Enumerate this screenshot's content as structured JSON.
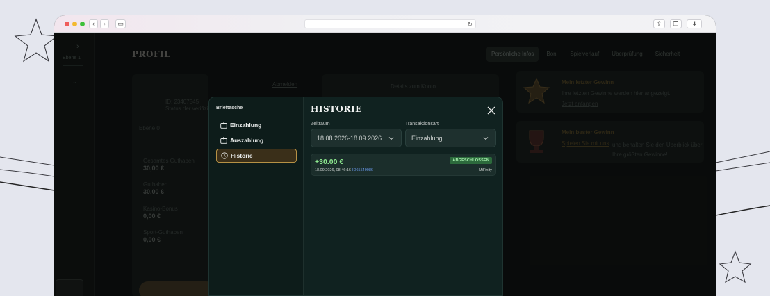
{
  "page": {
    "title": "PROFIL",
    "tabs": [
      {
        "label": "Persönliche Infos"
      },
      {
        "label": "Boni"
      },
      {
        "label": "Spielverlauf"
      },
      {
        "label": "Überprüfung"
      },
      {
        "label": "Sicherheit"
      }
    ],
    "rail": {
      "level": "Ebene 1"
    },
    "account": {
      "id": "ID: 23407545",
      "status": "Status der verifizi...",
      "level": "Ebene 0",
      "link": "Abmelden",
      "details_title": "Details zum Konto",
      "balances": [
        {
          "label": "Gesamtes Guthaben",
          "value": "30,00 €"
        },
        {
          "label": "Guthaben",
          "value": "30,00 €"
        },
        {
          "label": "Kasino-Bonus",
          "value": "0,00 €"
        },
        {
          "label": "Sport-Guthaben",
          "value": "0,00 €"
        }
      ]
    },
    "wins": {
      "last_title": "Mein letzter Gewinn",
      "last_text": "Ihre letzten Gewinne werden hier angezeigt.",
      "last_link": "Jetzt anfangen",
      "best_title": "Mein bester Gewinn",
      "best_link": "Spielen Sie mit uns",
      "best_text": "und behalten Sie den Überblick über Ihre größten Gewinne!"
    }
  },
  "modal": {
    "sidebar_title": "Brieftasche",
    "sidebar_items": [
      {
        "label": "Einzahlung",
        "icon": "wallet-in-icon",
        "active": false
      },
      {
        "label": "Auszahlung",
        "icon": "wallet-out-icon",
        "active": false
      },
      {
        "label": "Historie",
        "icon": "history-icon",
        "active": true
      }
    ],
    "title": "HISTORIE",
    "period_label": "Zeitraum",
    "period_value": "18.08.2026-18.09.2026",
    "type_label": "Transaktionsart",
    "type_value": "Einzahlung",
    "transactions": [
      {
        "amount": "+30.00 €",
        "status": "ABGESCHLOSSEN",
        "datetime": "18.09.2026, 08:46:16",
        "id": "ID65549086",
        "provider": "MiFinity"
      }
    ]
  },
  "colors": {
    "accent_gold": "#b69145",
    "success_green": "#8de88f",
    "badge_green": "#2c6a3c",
    "link_blue": "#6c9cf0"
  }
}
